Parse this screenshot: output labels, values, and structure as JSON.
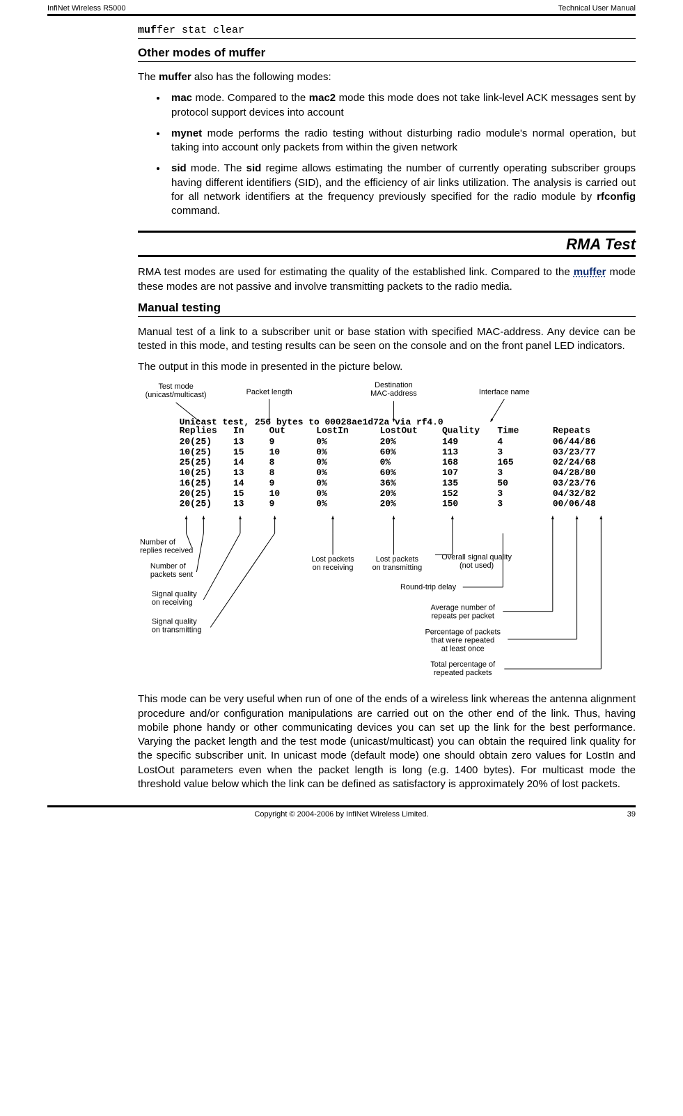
{
  "header": {
    "left": "InfiNet Wireless R5000",
    "right": "Technical User Manual"
  },
  "cmd": {
    "bold": "muf",
    "rest": "fer stat clear"
  },
  "sections": {
    "other_modes_title": "Other modes of muffer",
    "intro": {
      "a": "The ",
      "b": "muffer",
      "c": " also has the following modes:"
    },
    "bullets": [
      {
        "segs": [
          {
            "b": true,
            "t": "mac"
          },
          {
            "t": " mode. Compared to the "
          },
          {
            "b": true,
            "t": "mac2"
          },
          {
            "t": " mode this mode does not take link-level ACK messages sent by protocol support devices into account"
          }
        ]
      },
      {
        "segs": [
          {
            "b": true,
            "t": "mynet"
          },
          {
            "t": " mode performs the radio testing without disturbing radio module's normal operation, but taking into account only packets from within the given network"
          }
        ]
      },
      {
        "segs": [
          {
            "b": true,
            "t": "sid"
          },
          {
            "t": " mode. The "
          },
          {
            "b": true,
            "t": "sid"
          },
          {
            "t": " regime allows estimating the number of currently operating subscriber groups having different identifiers (SID), and the efficiency of air links utilization. The analysis is carried out for all network identifiers at the frequency previously specified for the radio module by "
          },
          {
            "b": true,
            "t": "rfconfig"
          },
          {
            "t": " command."
          }
        ]
      }
    ],
    "rma_title": "RMA Test",
    "rma_p1": {
      "a": "RMA test modes are used for estimating the quality of the established link. Compared to the ",
      "link": "muffer",
      "b": " mode these modes are not passive and involve transmitting packets to the radio media."
    },
    "manual_title": "Manual testing",
    "manual_p1": "Manual test of a link to a subscriber unit or base station with specified MAC-address. Any device can be tested in this mode, and testing results can be seen on the console and on the front panel LED indicators.",
    "manual_p2": "The output in this mode in presented in the picture below.",
    "last_para": "This mode can be very useful when run of one of the ends of a wireless link whereas the antenna alignment procedure and/or configuration manipulations are carried out on the other end of the link. Thus, having mobile phone handy or other communicating devices you can set up the link for the best performance. Varying the packet length and the test mode (unicast/multicast) you can obtain the required link quality for the specific subscriber unit. In unicast mode (default mode) one should obtain zero values for LostIn and LostOut parameters even when the packet length is long (e.g. 1400 bytes). For multicast mode the threshold value below which the link can be defined as satisfactory is approximately 20% of lost packets."
  },
  "figure": {
    "top_labels": {
      "test_mode": "Test mode\n(unicast/multicast)",
      "packet_length": "Packet length",
      "dest_mac": "Destination\nMAC-address",
      "iface": "Interface name"
    },
    "title_line": "Unicast test, 256 bytes to 00028ae1d72a via rf4.0",
    "columns": [
      "Replies",
      "In",
      "Out",
      "LostIn",
      "LostOut",
      "Quality",
      "Time",
      "Repeats"
    ],
    "rows": [
      [
        "20(25)",
        "13",
        "9",
        "0%",
        "20%",
        "149",
        "4",
        "06/44/86"
      ],
      [
        "10(25)",
        "15",
        "10",
        "0%",
        "60%",
        "113",
        "3",
        "03/23/77"
      ],
      [
        "25(25)",
        "14",
        "8",
        "0%",
        "0%",
        "168",
        "165",
        "02/24/68"
      ],
      [
        "10(25)",
        "13",
        "8",
        "0%",
        "60%",
        "107",
        "3",
        "04/28/80"
      ],
      [
        "16(25)",
        "14",
        "9",
        "0%",
        "36%",
        "135",
        "50",
        "03/23/76"
      ],
      [
        "20(25)",
        "15",
        "10",
        "0%",
        "20%",
        "152",
        "3",
        "04/32/82"
      ],
      [
        "20(25)",
        "13",
        "9",
        "0%",
        "20%",
        "150",
        "3",
        "00/06/48"
      ]
    ],
    "bottom_labels": {
      "replies_recv": "Number of\nreplies received",
      "packets_sent": "Number of\npackets sent",
      "sq_rx": "Signal quality\non receiving",
      "sq_tx": "Signal quality\non transmitting",
      "lost_rx": "Lost packets\non receiving",
      "lost_tx": "Lost packets\non transmitting",
      "overall_q": "Overall signal quality\n(not used)",
      "rtd": "Round-trip delay",
      "avg_repeats": "Average number of\nrepeats per packet",
      "pct_repeated": "Percentage of packets\nthat were repeated\nat least once",
      "total_pct": "Total percentage of\nrepeated packets"
    }
  },
  "footer": {
    "copyright": "Copyright © 2004-2006 by InfiNet Wireless Limited.",
    "page": "39"
  }
}
